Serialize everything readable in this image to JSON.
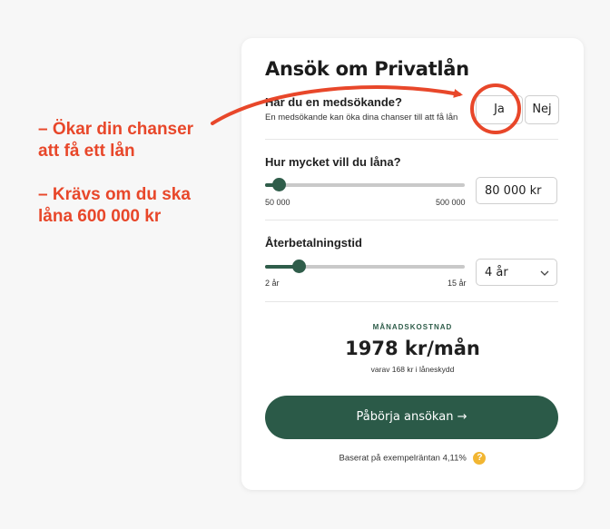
{
  "annotation": {
    "line1": "– Ökar din chanser",
    "line2": "att få ett lån",
    "line3": "– Krävs om du ska",
    "line4": "låna 600 000 kr",
    "color": "#e8472a"
  },
  "form": {
    "title": "Ansök om Privatlån",
    "co_applicant": {
      "question": "Har du en medsökande?",
      "hint": "En medsökande kan öka dina chanser till att få lån",
      "yes_label": "Ja",
      "no_label": "Nej"
    },
    "amount": {
      "question": "Hur mycket vill du låna?",
      "min_label": "50 000",
      "max_label": "500 000",
      "value": "80 000 kr",
      "slider_fraction": 0.07
    },
    "term": {
      "question": "Återbetalningstid",
      "min_label": "2 år",
      "max_label": "15 år",
      "value": "4 år",
      "slider_fraction": 0.17
    },
    "cost": {
      "label": "MÅNADSKOSTNAD",
      "value": "1978 kr/mån",
      "sub": "varav 168 kr i låneskydd"
    },
    "cta_label": "Påbörja ansökan →",
    "footnote": "Baserat på exempelräntan 4,11%",
    "help_icon_glyph": "?",
    "accent_color": "#2b5a48"
  }
}
